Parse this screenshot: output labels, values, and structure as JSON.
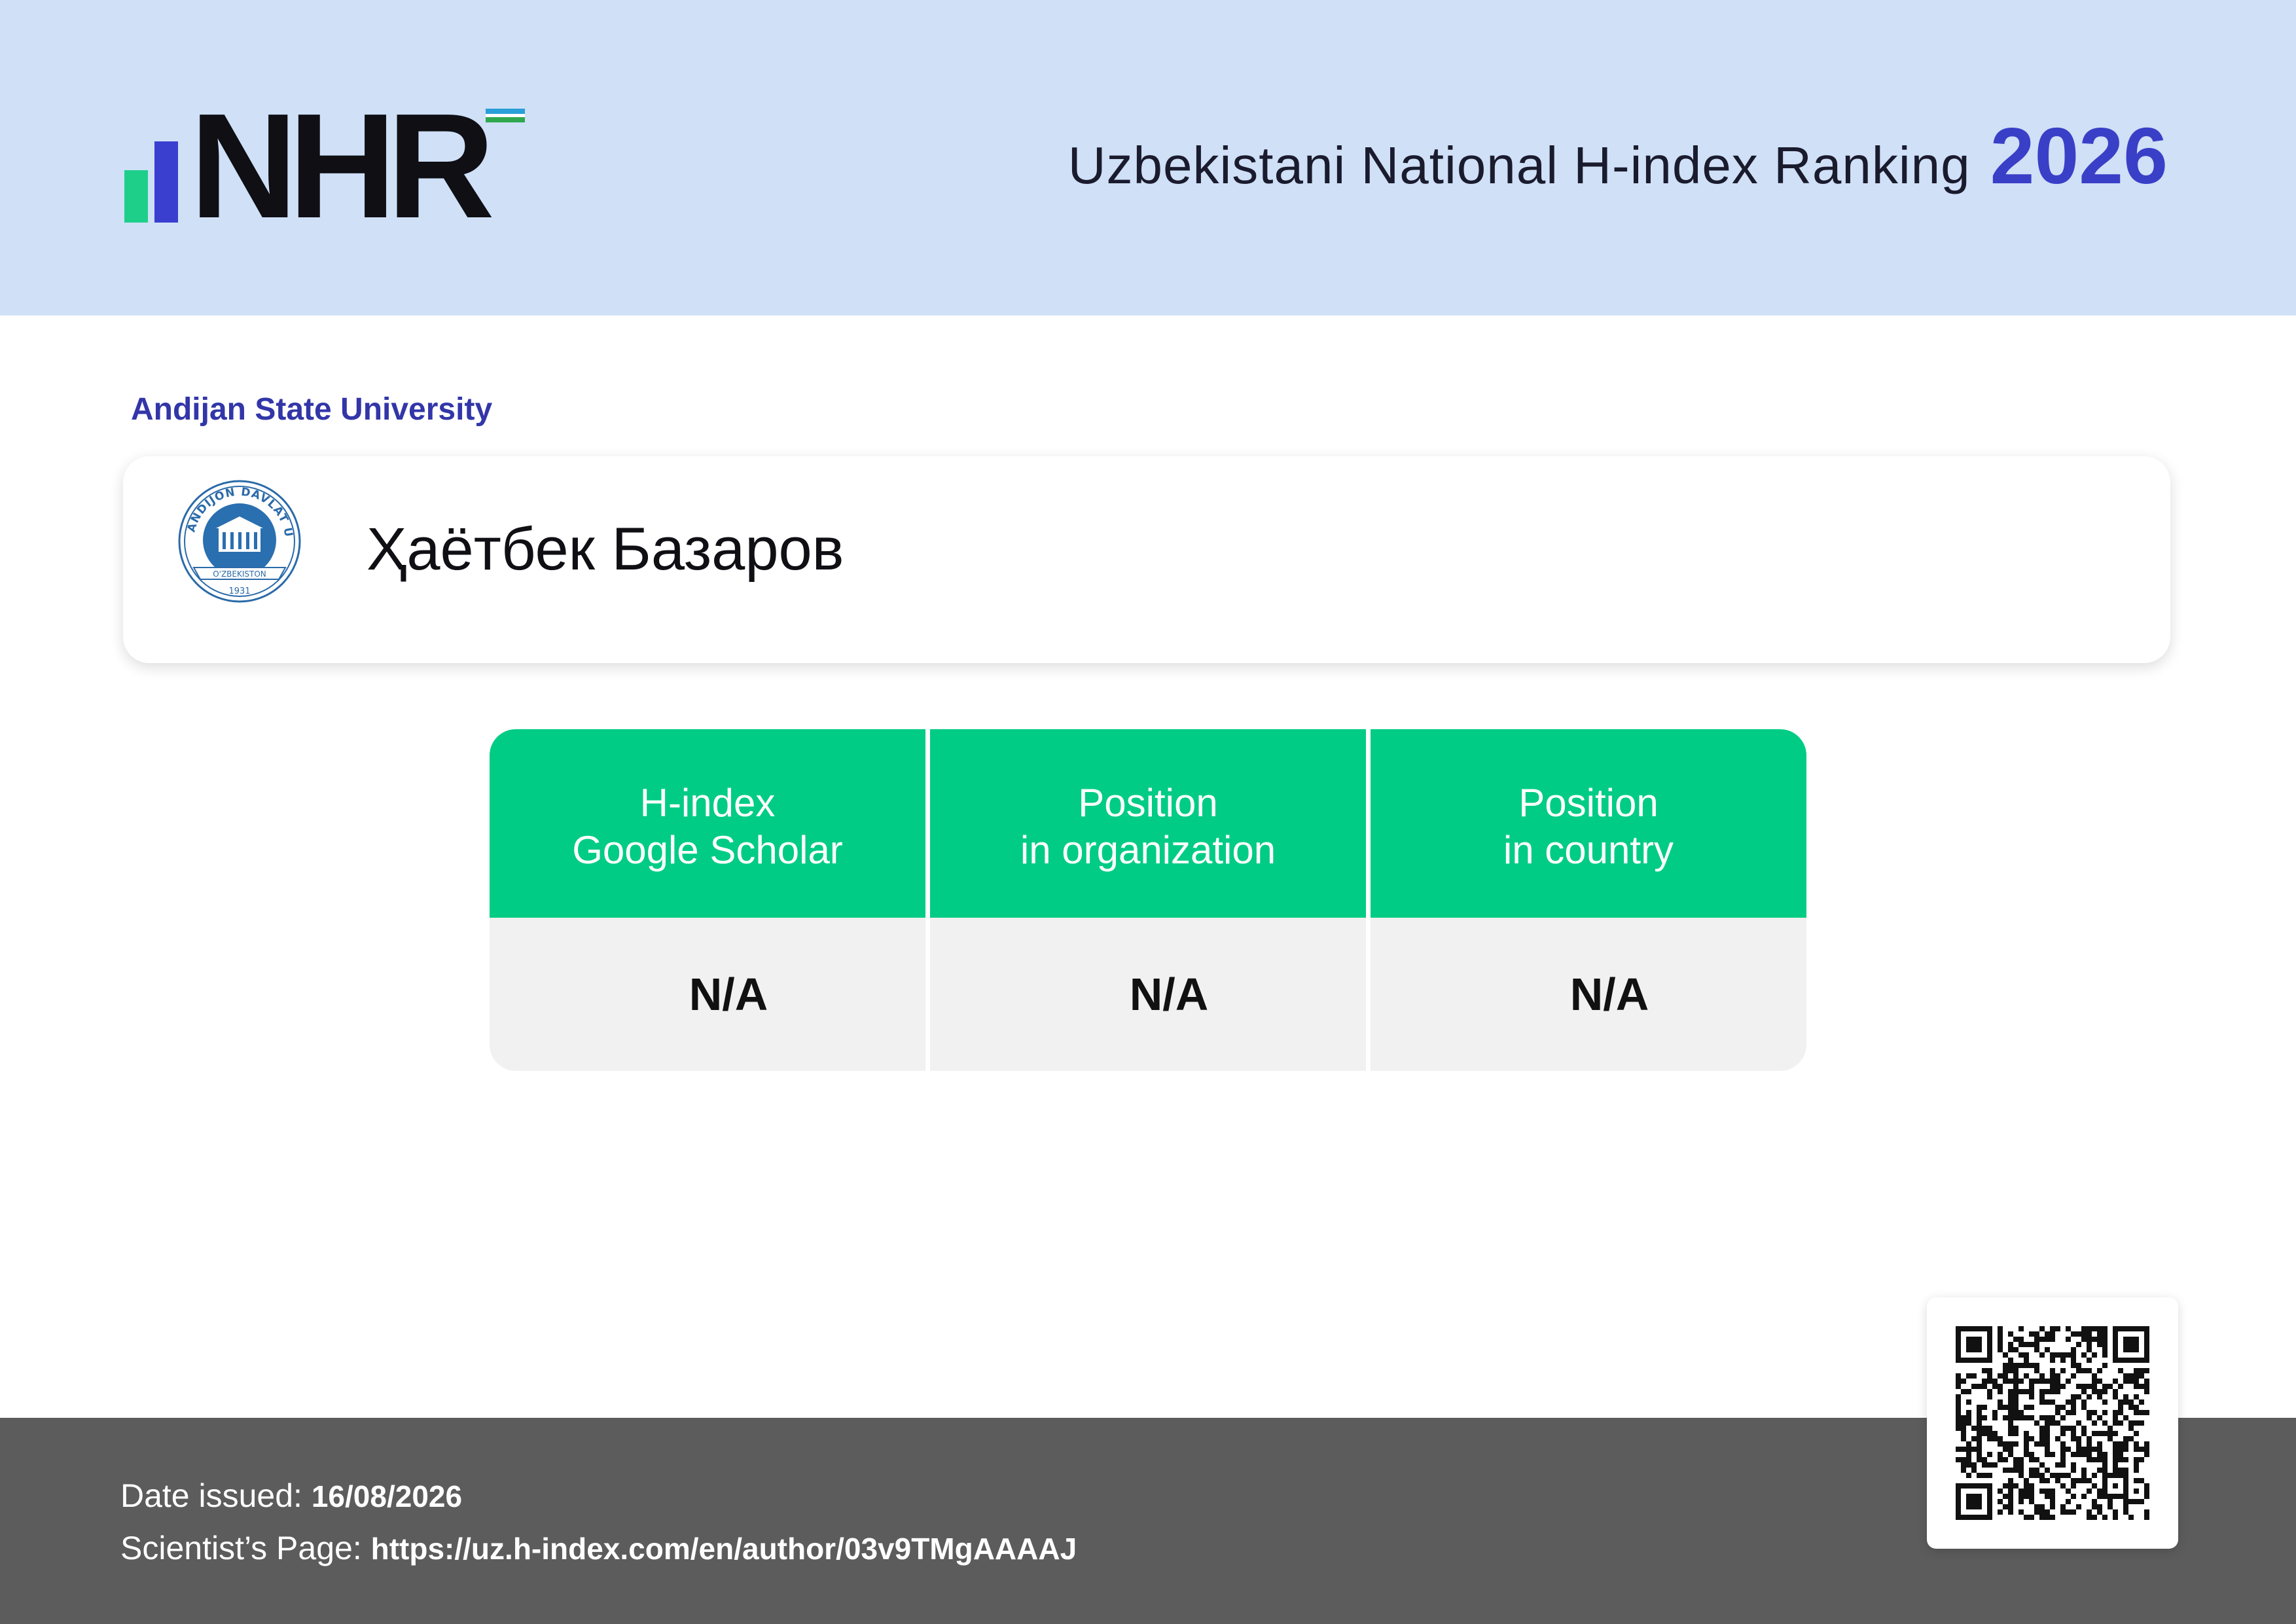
{
  "header": {
    "logo_text": "NHR",
    "title": "Uzbekistani National H-index Ranking",
    "year": "2026"
  },
  "organization": {
    "name": "Andijan State University",
    "seal_text": "ANDIJON DAVLAT UNIVERSITETI",
    "seal_country": "O'ZBEKISTON",
    "seal_year": "1931"
  },
  "scientist": {
    "name": "Ҳаётбек Базаров"
  },
  "stats": [
    {
      "label_line1": "H-index",
      "label_line2": "Google Scholar",
      "value": "N/A"
    },
    {
      "label_line1": "Position",
      "label_line2": "in organization",
      "value": "N/A"
    },
    {
      "label_line1": "Position",
      "label_line2": "in country",
      "value": "N/A"
    }
  ],
  "footer": {
    "date_label": "Date issued:",
    "date_value": "16/08/2026",
    "page_label": "Scientist’s Page:",
    "page_url": "https://uz.h-index.com/en/author/03v9TMgAAAAJ"
  },
  "colors": {
    "header_bg": "#cfe0f7",
    "accent_blue": "#3a3fc7",
    "table_green": "#00cc85",
    "footer_bg": "#5c5c5c"
  }
}
